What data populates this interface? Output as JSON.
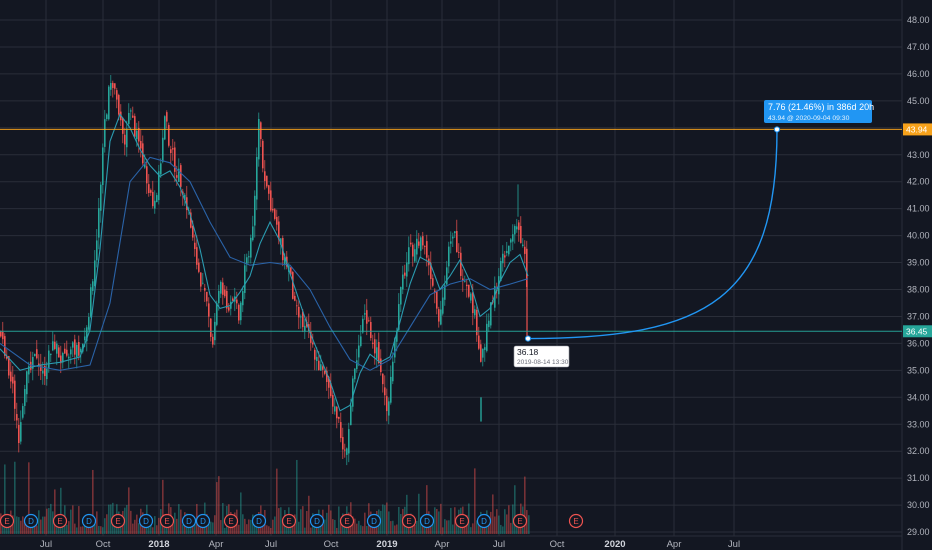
{
  "chart_data": {
    "type": "candlestick",
    "x_ticks": [
      "Jul",
      "Oct",
      "2018",
      "Apr",
      "Jul",
      "Oct",
      "2019",
      "Apr",
      "Jul",
      "Oct",
      "2020",
      "Apr",
      "Jul"
    ],
    "x_tick_bold": [
      "2018",
      "2019",
      "2020"
    ],
    "y_ticks": [
      "29.00",
      "30.00",
      "31.00",
      "32.00",
      "33.00",
      "34.00",
      "35.00",
      "36.00",
      "37.00",
      "38.00",
      "39.00",
      "40.00",
      "41.00",
      "42.00",
      "43.00",
      "44.00",
      "45.00",
      "46.00",
      "47.00",
      "48.00"
    ],
    "ylim": [
      29,
      48.5
    ],
    "price_path": [
      [
        0,
        36.3
      ],
      [
        6,
        35.2
      ],
      [
        12,
        34.3
      ],
      [
        18,
        32.6
      ],
      [
        24,
        34.6
      ],
      [
        30,
        35.0
      ],
      [
        36,
        35.6
      ],
      [
        42,
        34.8
      ],
      [
        48,
        35.5
      ],
      [
        54,
        36.0
      ],
      [
        60,
        35.4
      ],
      [
        66,
        35.3
      ],
      [
        72,
        35.9
      ],
      [
        78,
        35.6
      ],
      [
        84,
        36.2
      ],
      [
        90,
        37.8
      ],
      [
        96,
        40.0
      ],
      [
        100,
        41.8
      ],
      [
        104,
        44.2
      ],
      [
        108,
        45.3
      ],
      [
        112,
        45.7
      ],
      [
        116,
        45.0
      ],
      [
        120,
        44.0
      ],
      [
        124,
        43.2
      ],
      [
        128,
        44.8
      ],
      [
        132,
        44.2
      ],
      [
        136,
        43.6
      ],
      [
        140,
        43.2
      ],
      [
        146,
        42.2
      ],
      [
        152,
        41.2
      ],
      [
        158,
        42.1
      ],
      [
        164,
        44.3
      ],
      [
        168,
        43.6
      ],
      [
        172,
        42.9
      ],
      [
        176,
        42.4
      ],
      [
        182,
        41.8
      ],
      [
        188,
        40.8
      ],
      [
        194,
        39.3
      ],
      [
        200,
        38.4
      ],
      [
        206,
        37.3
      ],
      [
        212,
        36.1
      ],
      [
        216,
        37.6
      ],
      [
        220,
        38.1
      ],
      [
        226,
        37.3
      ],
      [
        232,
        37.8
      ],
      [
        238,
        36.9
      ],
      [
        244,
        38.6
      ],
      [
        250,
        39.9
      ],
      [
        254,
        41.2
      ],
      [
        258,
        44.4
      ],
      [
        262,
        42.7
      ],
      [
        266,
        41.8
      ],
      [
        270,
        41.2
      ],
      [
        276,
        40.2
      ],
      [
        282,
        39.3
      ],
      [
        288,
        38.8
      ],
      [
        294,
        37.3
      ],
      [
        300,
        36.8
      ],
      [
        306,
        36.4
      ],
      [
        312,
        35.8
      ],
      [
        318,
        35.2
      ],
      [
        324,
        34.7
      ],
      [
        330,
        34.2
      ],
      [
        336,
        33.4
      ],
      [
        340,
        32.5
      ],
      [
        344,
        31.8
      ],
      [
        348,
        32.9
      ],
      [
        352,
        34.4
      ],
      [
        358,
        35.7
      ],
      [
        364,
        37.2
      ],
      [
        370,
        36.4
      ],
      [
        376,
        35.6
      ],
      [
        382,
        34.6
      ],
      [
        386,
        33.4
      ],
      [
        390,
        34.9
      ],
      [
        396,
        36.7
      ],
      [
        402,
        38.4
      ],
      [
        408,
        39.3
      ],
      [
        414,
        39.6
      ],
      [
        420,
        39.9
      ],
      [
        426,
        39.3
      ],
      [
        432,
        38.3
      ],
      [
        438,
        37.1
      ],
      [
        442,
        37.7
      ],
      [
        448,
        39.4
      ],
      [
        454,
        40.0
      ],
      [
        460,
        38.8
      ],
      [
        466,
        38.3
      ],
      [
        472,
        37.4
      ],
      [
        476,
        36.6
      ],
      [
        480,
        35.4
      ],
      [
        484,
        36.0
      ],
      [
        488,
        36.9
      ],
      [
        494,
        37.9
      ],
      [
        500,
        38.9
      ],
      [
        506,
        39.3
      ],
      [
        512,
        40.1
      ],
      [
        516,
        40.6
      ],
      [
        520,
        39.8
      ],
      [
        524,
        39.2
      ],
      [
        527,
        37.2
      ],
      [
        528,
        36.18
      ]
    ],
    "moving_average_fast": [
      [
        0,
        35.8
      ],
      [
        20,
        35.0
      ],
      [
        40,
        35.2
      ],
      [
        60,
        35.3
      ],
      [
        80,
        35.5
      ],
      [
        90,
        36.5
      ],
      [
        100,
        39.5
      ],
      [
        110,
        43.5
      ],
      [
        120,
        44.5
      ],
      [
        130,
        44.0
      ],
      [
        140,
        43.2
      ],
      [
        150,
        42.6
      ],
      [
        160,
        42.2
      ],
      [
        170,
        42.4
      ],
      [
        180,
        41.8
      ],
      [
        190,
        40.8
      ],
      [
        200,
        39.5
      ],
      [
        210,
        37.8
      ],
      [
        220,
        37.3
      ],
      [
        230,
        37.4
      ],
      [
        240,
        37.9
      ],
      [
        250,
        38.5
      ],
      [
        260,
        39.7
      ],
      [
        270,
        40.5
      ],
      [
        280,
        39.8
      ],
      [
        290,
        38.6
      ],
      [
        300,
        37.5
      ],
      [
        310,
        36.4
      ],
      [
        320,
        35.5
      ],
      [
        330,
        34.6
      ],
      [
        340,
        33.5
      ],
      [
        350,
        33.7
      ],
      [
        360,
        34.9
      ],
      [
        370,
        35.6
      ],
      [
        380,
        35.3
      ],
      [
        390,
        35.5
      ],
      [
        400,
        36.8
      ],
      [
        410,
        38.2
      ],
      [
        420,
        39.2
      ],
      [
        430,
        39.0
      ],
      [
        440,
        38.0
      ],
      [
        450,
        38.5
      ],
      [
        460,
        39.1
      ],
      [
        470,
        38.3
      ],
      [
        480,
        37.0
      ],
      [
        490,
        37.3
      ],
      [
        500,
        38.3
      ],
      [
        510,
        39.0
      ],
      [
        520,
        39.3
      ],
      [
        528,
        38.5
      ]
    ],
    "moving_average_slow": [
      [
        0,
        36.0
      ],
      [
        30,
        35.2
      ],
      [
        60,
        35.0
      ],
      [
        90,
        35.2
      ],
      [
        110,
        37.5
      ],
      [
        130,
        42.0
      ],
      [
        150,
        42.9
      ],
      [
        170,
        42.7
      ],
      [
        190,
        42.0
      ],
      [
        210,
        40.5
      ],
      [
        230,
        39.2
      ],
      [
        250,
        38.9
      ],
      [
        270,
        39.0
      ],
      [
        290,
        38.9
      ],
      [
        310,
        38.0
      ],
      [
        330,
        36.6
      ],
      [
        350,
        35.4
      ],
      [
        370,
        35.0
      ],
      [
        390,
        35.4
      ],
      [
        410,
        36.6
      ],
      [
        430,
        37.8
      ],
      [
        450,
        38.2
      ],
      [
        470,
        38.4
      ],
      [
        490,
        38.0
      ],
      [
        510,
        38.2
      ],
      [
        528,
        38.4
      ]
    ],
    "volume_note": "volume histogram bars along bottom, green and red",
    "events": [
      {
        "type": "E",
        "color": "red"
      },
      {
        "type": "D",
        "color": "blue"
      },
      {
        "type": "E",
        "color": "red"
      },
      {
        "type": "D",
        "color": "blue"
      },
      {
        "type": "E",
        "color": "red"
      },
      {
        "type": "D",
        "color": "blue"
      },
      {
        "type": "E",
        "color": "red"
      },
      {
        "type": "D",
        "color": "blue"
      },
      {
        "type": "E",
        "color": "red"
      },
      {
        "type": "D",
        "color": "blue"
      },
      {
        "type": "E",
        "color": "red"
      },
      {
        "type": "D",
        "color": "blue"
      },
      {
        "type": "E",
        "color": "red"
      },
      {
        "type": "D",
        "color": "blue"
      },
      {
        "type": "E",
        "color": "red"
      },
      {
        "type": "D",
        "color": "blue"
      },
      {
        "type": "E",
        "color": "red"
      },
      {
        "type": "E",
        "color": "red"
      }
    ],
    "horizontal_lines": [
      {
        "value": 43.94,
        "label": "43.94",
        "color": "#f7a21b"
      },
      {
        "value": 36.45,
        "label": "36.45",
        "color": "#26a69a"
      }
    ],
    "annotation": {
      "start": {
        "value": 36.18,
        "date": "2019-08-14 13:30",
        "label": "36.18"
      },
      "end": {
        "value": 43.94,
        "date": "2020-09-04 09:30"
      },
      "headline": "7.76 (21.46%) in 386d 20h",
      "subline": "43.94 @ 2020-09-04 09:30"
    }
  },
  "colors": {
    "background": "#131722",
    "grid": "#2a2e39",
    "up": "#26a69a",
    "down": "#ef5350",
    "ma_fast": "#2a9bb0",
    "ma_slow": "#2a63a8",
    "projection": "#2196f3",
    "text": "#b2b5be"
  }
}
